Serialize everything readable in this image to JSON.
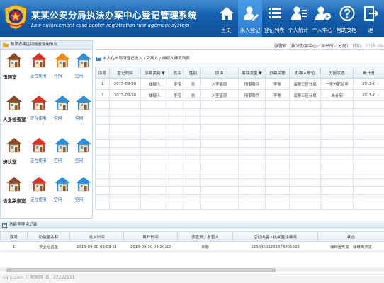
{
  "header": {
    "title_cn": "某某公安分局执法办案中心登记管理系统",
    "title_en": "Law enforcement case center registration management system",
    "nav": [
      {
        "label": "首页",
        "icon": "home-icon"
      },
      {
        "label": "来人登记",
        "icon": "user-register-icon",
        "active": true
      },
      {
        "label": "登记列表",
        "icon": "list-icon"
      },
      {
        "label": "个人统计",
        "icon": "user-stats-icon"
      },
      {
        "label": "个人中心",
        "icon": "user-center-icon"
      },
      {
        "label": "帮助文档",
        "icon": "help-icon"
      },
      {
        "label": "退",
        "icon": "logout-icon"
      }
    ]
  },
  "left_panel": {
    "heading": "执法办案区功能室使用情况",
    "rooms": [
      {
        "name": "讯问室",
        "statuses": [
          "正在使用",
          "待扫",
          "空闲"
        ]
      },
      {
        "name": "人身检查室",
        "statuses": [
          "正在使用",
          "空闲",
          "空闲"
        ]
      },
      {
        "name": "辨认室",
        "statuses": [
          "正在使用",
          "空闲",
          "空闲"
        ]
      },
      {
        "name": "信息采集室",
        "statuses": [
          "正在使用",
          "空闲",
          "空闲"
        ]
      }
    ]
  },
  "topbar": {
    "user": "张警官（执法办案中心／派出所／分局）",
    "date_label": "日期：2015-09-28"
  },
  "breadcrumb": "本人在本局所登记进入 / 受案人 / 嫌疑人情况列表",
  "main_table": {
    "columns": [
      "序号",
      "登记时间",
      "涉案类别 ▼",
      "姓名",
      "性别",
      "原由",
      "案件类型 ▼",
      "办案民警",
      "办案人单位",
      "分配状态",
      "离开时"
    ],
    "rows": [
      [
        "1",
        "2015-09-30",
        "嫌疑人",
        "李宝",
        "男",
        "入室盗窃",
        "刑事案件",
        "李警",
        "海警三区分局",
        "一至分配监室",
        "2015-0"
      ],
      [
        "2",
        "2015-09-30",
        "嫌疑人",
        "李宝",
        "男",
        "入室盗窃",
        "刑事案件",
        "李警",
        "海警三区分局",
        "未分配",
        "2015-0"
      ]
    ]
  },
  "bottom_panel": {
    "heading": "功能室使用记录",
    "columns": [
      "序号",
      "功能室名称",
      "进入时间",
      "离开时间",
      "侦查员 / 看管人",
      "活动内容 / 执问登级编号",
      "状态"
    ],
    "rows": [
      [
        "1",
        "安全检查室",
        "2015-09-30 09:09:11",
        "2015-09-30 09:20:23",
        "李警",
        "12584501231874581323",
        "嫌疑进安置 , 嫌疑离安置"
      ]
    ]
  },
  "watermark": "nipic.com ⓒ 昵图网  ID：22292111",
  "colors": {
    "header": "#1560ae",
    "active_nav": "#2a7bd0",
    "roof_red": "#d6342a",
    "roof_orange": "#f08a1c",
    "roof_blue": "#2d8fd9",
    "roof_brown": "#8a4b2a"
  }
}
